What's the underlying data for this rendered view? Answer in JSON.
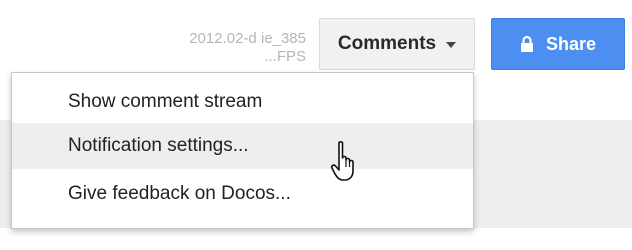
{
  "header": {
    "doc_info_line1": "2012.02-d ie_385",
    "doc_info_line2": "...FPS",
    "comments_label": "Comments",
    "share_label": "Share"
  },
  "menu": {
    "items": [
      {
        "label": "Show comment stream"
      },
      {
        "label": "Notification settings..."
      },
      {
        "label": "Give feedback on Docos..."
      }
    ]
  },
  "icons": {
    "dropdown_caret": "chevron-down-icon",
    "share_lock": "lock-icon",
    "pointer": "hand-pointer-icon"
  },
  "colors": {
    "share_button": "#4d8ff0",
    "menu_hover": "#eeeeee",
    "comments_button": "#f1f1f1"
  }
}
